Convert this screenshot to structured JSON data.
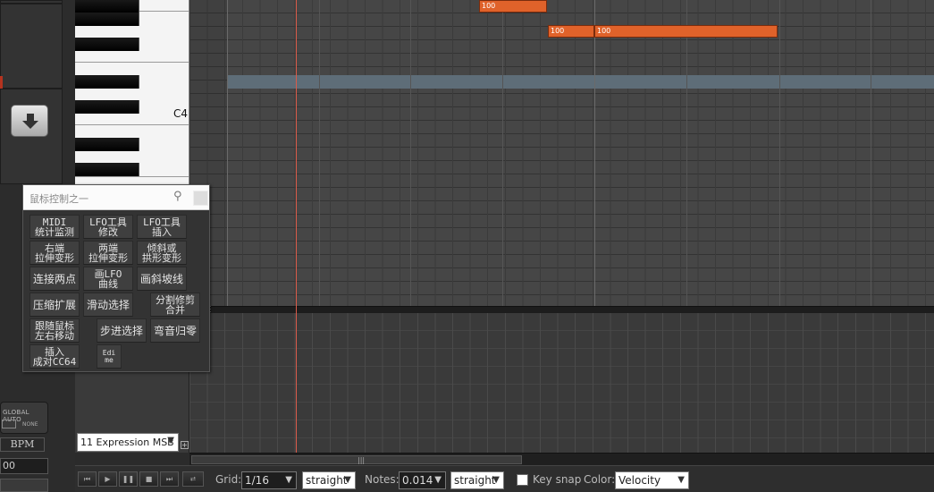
{
  "piano": {
    "note_label": "C4"
  },
  "notes": [
    {
      "velocity": "100"
    },
    {
      "velocity": "100"
    },
    {
      "velocity": "100"
    }
  ],
  "panel": {
    "title": "鼠标控制之一",
    "pin_icon": "pin-icon",
    "buttons": [
      "MIDI\n统计监测",
      "LFO工具\n修改",
      "LFO工具\n插入",
      "右端\n拉伸变形",
      "两端\n拉伸变形",
      "倾斜或\n拱形变形",
      "连接两点",
      "画LFO\n曲线",
      "画斜坡线",
      "压缩扩展",
      "滑动选择",
      "分割修剪\n合并",
      "跟随鼠标\n左右移动",
      "步进选择",
      "弯音归零",
      "插入\n成对CC64",
      "Edi\nme"
    ]
  },
  "left": {
    "global_auto_title": "GLOBAL AUTO",
    "global_auto_state": "NONE",
    "bpm_label": "BPM",
    "bpm_value": "00"
  },
  "cc_lane": {
    "selected": "11 Expression MSB",
    "add_symbol": "+"
  },
  "toolbar": {
    "grid_label": "Grid:",
    "grid_value": "1/16",
    "grid_mode": "straight",
    "notes_label": "Notes:",
    "notes_value": "0.014",
    "notes_mode": "straight",
    "key_snap_label": "Key snap",
    "key_snap_checked": false,
    "color_label": "Color:",
    "color_value": "Velocity",
    "transport": [
      "skip-back-icon",
      "play-icon",
      "pause-icon",
      "stop-icon",
      "skip-forward-icon",
      "loop-icon"
    ]
  },
  "colors": {
    "note": "#e0622a",
    "playhead": "#d95b4a",
    "highlight_row": "#5e6d78"
  }
}
